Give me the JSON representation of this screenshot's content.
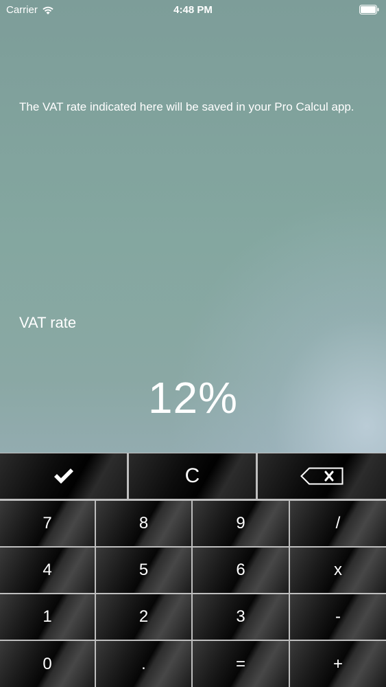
{
  "status_bar": {
    "carrier": "Carrier",
    "time": "4:48 PM",
    "wifi_icon": "wifi-icon",
    "battery_icon": "battery-icon"
  },
  "main": {
    "info_text": "The VAT rate indicated here will be saved in your Pro Calcul app.",
    "vat_label": "VAT rate",
    "vat_value": "12%"
  },
  "keypad": {
    "top_row": {
      "confirm_icon": "checkmark-icon",
      "clear_label": "C",
      "delete_icon": "backspace-icon"
    },
    "rows": [
      [
        "7",
        "8",
        "9",
        "/"
      ],
      [
        "4",
        "5",
        "6",
        "x"
      ],
      [
        "1",
        "2",
        "3",
        "-"
      ],
      [
        "0",
        ".",
        "=",
        "+"
      ]
    ]
  },
  "colors": {
    "background_top": "#7d9d99",
    "background_bottom": "#a2b5c2",
    "text": "#ffffff",
    "key_dark": "#060606"
  }
}
